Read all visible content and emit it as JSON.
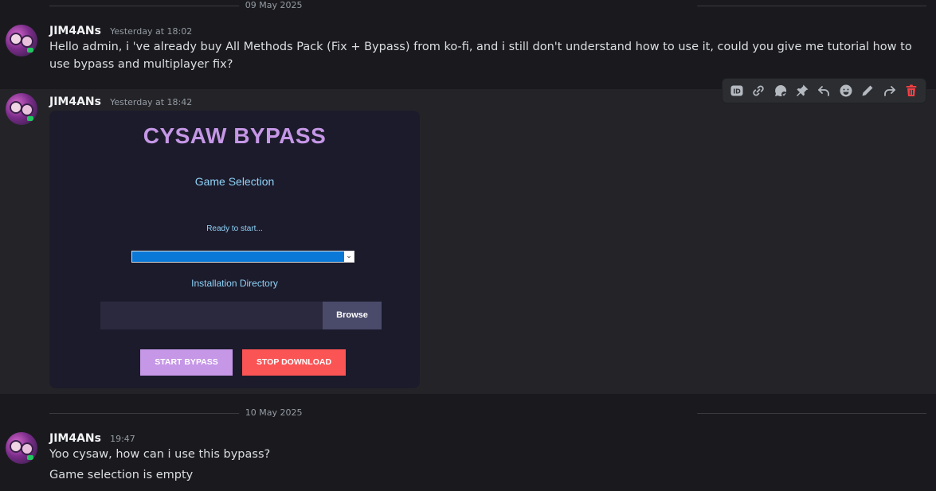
{
  "dividers": {
    "first": "09 May 2025",
    "second": "10 May 2025"
  },
  "messages": [
    {
      "author": "JIM4ANs",
      "timestamp": "Yesterday at 18:02",
      "text": "Hello admin, i 've already buy All Methods Pack (Fix + Bypass) from ko-fi, and i still don't understand how to use it, could you give me tutorial how to use bypass and multiplayer fix?"
    },
    {
      "author": "JIM4ANs",
      "timestamp": "Yesterday at 18:42",
      "attachment": {
        "title": "CYSAW BYPASS",
        "game_selection_label": "Game Selection",
        "status": "Ready to start...",
        "selected_game": "",
        "install_dir_label": "Installation Directory",
        "install_dir_value": "",
        "browse": "Browse",
        "start": "START BYPASS",
        "stop": "STOP DOWNLOAD"
      }
    },
    {
      "author": "JIM4ANs",
      "timestamp": "19:47",
      "lines": [
        "Yoo cysaw, how can i use this bypass?",
        "Game selection is empty"
      ]
    }
  ],
  "toolbar": {
    "icons": [
      "id-icon",
      "link-icon",
      "thread-icon",
      "pin-icon",
      "reply-icon",
      "emoji-icon",
      "edit-icon",
      "forward-icon",
      "delete-icon"
    ]
  },
  "colors": {
    "background": "#1a1a1e",
    "hover_row": "#242428",
    "app_title": "#c597e6",
    "app_label": "#8fd3f7",
    "start_button": "#c597e6",
    "stop_button": "#fb5455",
    "delete_icon": "#f23f43"
  }
}
